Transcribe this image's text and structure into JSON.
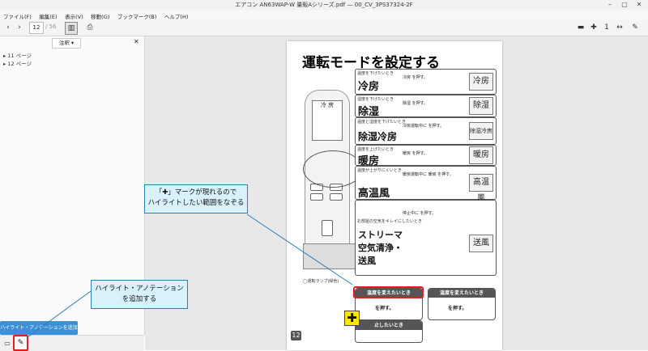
{
  "window": {
    "title": "エアコン AN63WAP-W 量販Aシリーズ.pdf — 00_CV_3PS37324-2F",
    "close_glyph": "✕",
    "minimize_glyph": "–",
    "maximize_glyph": "▢"
  },
  "menu": [
    "ファイル(F)",
    "編集(E)",
    "表示(V)",
    "移動(G)",
    "ブックマーク(B)",
    "ヘルプ(H)"
  ],
  "toolbar": {
    "page_current": "12",
    "page_total": "/ 56",
    "right_buttons": [
      "minus",
      "plus",
      "one",
      "fit"
    ]
  },
  "sidebar": {
    "select_label": "注釈",
    "tree_items": [
      "11 ページ",
      "12 ページ"
    ]
  },
  "document": {
    "heading": "運転モードを設定する",
    "page_number": "12",
    "remote_screen_text": "冷 房",
    "lamp_label": "◯運転ランプ(緑色)",
    "modes": [
      {
        "head": "温度を下げたいとき",
        "title": "冷房",
        "desc": "冷房 を押す。",
        "icon": "冷房"
      },
      {
        "head": "湿度を下げたいとき",
        "title": "除湿",
        "desc": "除湿 を押す。",
        "icon": "除湿"
      },
      {
        "head": "温度と湿度を下げたいとき",
        "title": "除湿冷房",
        "desc": "冷房運転中に を押す。",
        "icon": "除湿冷房"
      },
      {
        "head": "温度を上げたいとき",
        "title": "暖房",
        "desc": "暖房 を押す。",
        "icon": "暖房"
      },
      {
        "head": "温度が上がりにくいとき",
        "title": "高温風",
        "desc": "暖房運転中に 暖房 を押す。",
        "icon": "高温風"
      },
      {
        "head": "お部屋の空気をキレイにしたいとき",
        "title": "ストリーマ空気清浄・送風",
        "desc": "停止中に を押す。",
        "icon": "送風"
      }
    ],
    "bottom_left_head": "温度を変えたいとき",
    "bottom_right_head": "温度を変えたいとき",
    "press_text": "を押す。",
    "stop_head": "止したいとき"
  },
  "callouts": {
    "highlight_hint": "「✚」マークが現れるので\nハイライトしたい範囲をなぞる",
    "add_annotation": "ハイライト・アノテーション\nを追加する"
  },
  "tooltip": "ハイライト・アノテーションを追加する",
  "colors": {
    "accent_red": "#e21d1d",
    "callout_fill": "#d8f1fb",
    "callout_border": "#2b7fb8",
    "tooltip_blue": "#3d8fd6"
  }
}
